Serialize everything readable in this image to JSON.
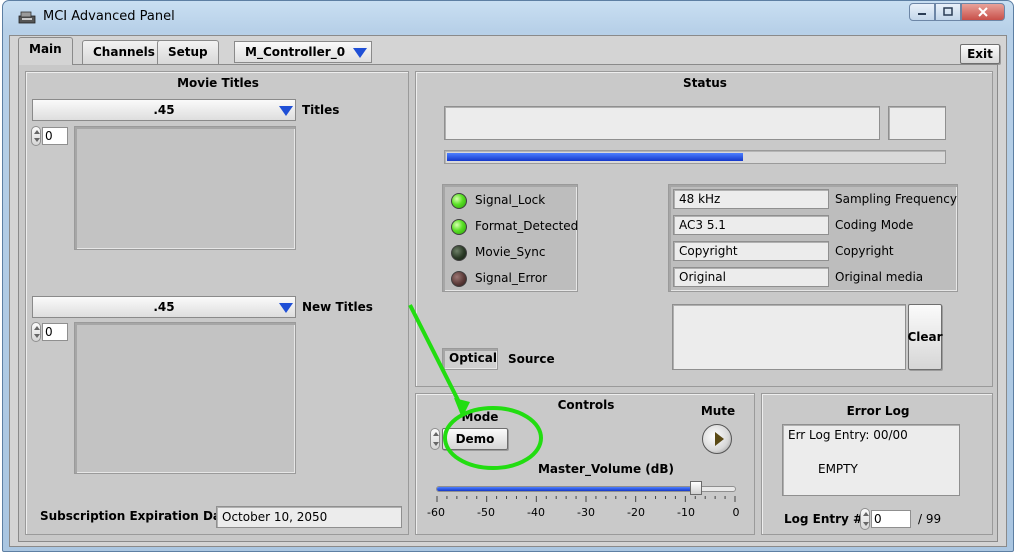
{
  "window": {
    "title": "MCI Advanced Panel"
  },
  "tabs": [
    {
      "label": "Main",
      "active": true
    },
    {
      "label": "Channels",
      "active": false
    },
    {
      "label": "Setup",
      "active": false
    }
  ],
  "controller_select": {
    "value": "M_Controller_0"
  },
  "exit_button": {
    "label": "Exit"
  },
  "movie_titles": {
    "heading": "Movie Titles",
    "titles_ring": {
      "value": ".45",
      "label": "Titles",
      "index": "0"
    },
    "new_titles_ring": {
      "value": ".45",
      "label": "New Titles",
      "index": "0"
    },
    "subscription": {
      "label": "Subscription Expiration Date",
      "value": "October 10, 2050"
    }
  },
  "status": {
    "heading": "Status",
    "progress_percent": 60,
    "indicators": [
      {
        "label": "Signal_Lock",
        "state": "on"
      },
      {
        "label": "Format_Detected",
        "state": "on"
      },
      {
        "label": "Movie_Sync",
        "state": "off"
      },
      {
        "label": "Signal_Error",
        "state": "off"
      }
    ],
    "info": [
      {
        "value": "48 kHz",
        "label": "Sampling Frequency"
      },
      {
        "value": "AC3 5.1",
        "label": "Coding Mode"
      },
      {
        "value": "Copyright",
        "label": "Copyright"
      },
      {
        "value": "Original",
        "label": "Original media"
      }
    ],
    "clear_label": "Clear",
    "source": {
      "value": "Optical",
      "label": "Source"
    }
  },
  "controls": {
    "heading": "Controls",
    "mode": {
      "label": "Mode",
      "value": "Demo"
    },
    "mute_label": "Mute",
    "volume": {
      "label": "Master_Volume (dB)",
      "value_db": -8,
      "min": -60,
      "max": 0,
      "ticks": [
        "-60",
        "-50",
        "-40",
        "-30",
        "-20",
        "-10",
        "0"
      ]
    }
  },
  "error_log": {
    "heading": "Error Log",
    "entry_text": "Err Log Entry: 00/00",
    "message": "EMPTY",
    "log_entry_label": "Log Entry #",
    "log_entry_value": "0",
    "log_total": "/ 99"
  },
  "colors": {
    "led_on": "#59e024",
    "progress_blue": "#1538c9",
    "annotation_green": "#22dd11"
  }
}
